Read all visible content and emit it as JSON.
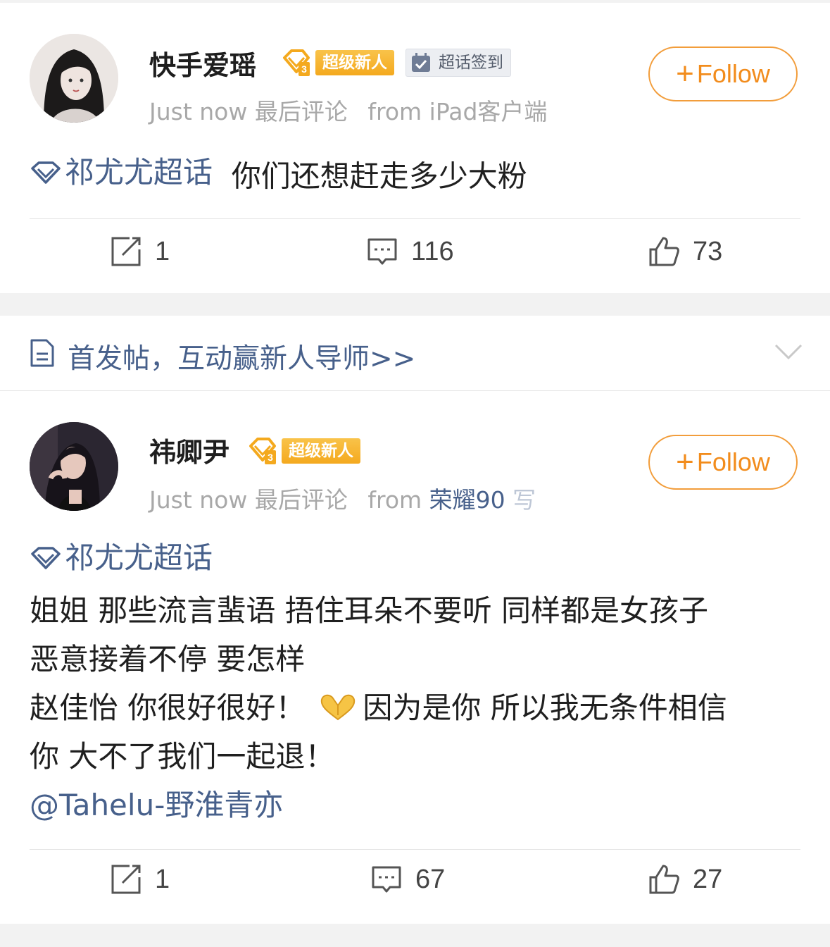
{
  "posts": [
    {
      "username": "快手爱瑶",
      "badge_new": "超级新人",
      "badge_checkin": "超话签到",
      "time": "Just now",
      "activity": "最后评论",
      "from_label": "from",
      "device": "iPad客户端",
      "follow_label": "Follow",
      "topic": "祁尤尤超话",
      "text": "你们还想赶走多少大粉",
      "reposts": "1",
      "comments": "116",
      "likes": "73"
    },
    {
      "username": "祎卿尹",
      "badge_new": "超级新人",
      "time": "Just now",
      "activity": "最后评论",
      "from_label": "from",
      "device": "荣耀90",
      "device_fade": "写",
      "follow_label": "Follow",
      "topic": "祁尤尤超话",
      "line1": "姐姐 那些流言蜚语 捂住耳朵不要听 同样都是女孩子",
      "line2": "恶意接着不停 要怎样",
      "line3a": "赵佳怡 你很好很好！",
      "line3b": "因为是你 所以我无条件相信",
      "line4": "你 大不了我们一起退！",
      "mention": "@Tahelu-野淮青亦",
      "reposts": "1",
      "comments": "67",
      "likes": "27"
    }
  ],
  "banner": {
    "text": "首发帖，互动赢新人导师>>"
  },
  "colors": {
    "link": "#47608b",
    "follow": "#f28c1c",
    "badge": "#f4a91e"
  },
  "icons": [
    "level-badge-icon",
    "checkin-icon",
    "topic-diamond-icon",
    "repost-icon",
    "comment-icon",
    "like-icon",
    "document-icon",
    "chevron-down-icon",
    "heart-hands-emoji"
  ]
}
